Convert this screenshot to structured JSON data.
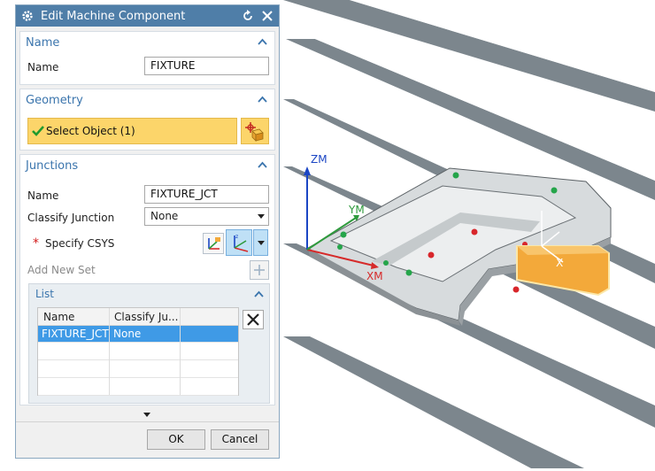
{
  "dialog": {
    "title": "Edit Machine Component",
    "icons": {
      "gear": "gear-icon",
      "reset": "reset-icon",
      "close": "close-icon"
    }
  },
  "name_section": {
    "header": "Name",
    "name_label": "Name",
    "name_value": "FIXTURE"
  },
  "geometry_section": {
    "header": "Geometry",
    "select_object_label": "Select Object (1)"
  },
  "junctions_section": {
    "header": "Junctions",
    "name_label": "Name",
    "name_value": "FIXTURE_JCT",
    "classify_label": "Classify Junction",
    "classify_value": "None",
    "required_marker": "*",
    "csys_label": "Specify CSYS",
    "add_new_set_label": "Add New Set",
    "list": {
      "header": "List",
      "columns": [
        "Name",
        "Classify Ju..."
      ],
      "rows": [
        {
          "name": "FIXTURE_JCT",
          "classify": "None",
          "selected": true
        }
      ]
    }
  },
  "buttons": {
    "ok": "OK",
    "cancel": "Cancel"
  },
  "viewport": {
    "axis_labels": {
      "zm": "ZM",
      "ym": "YM",
      "xm": "XM",
      "x": "X"
    }
  },
  "colors": {
    "titlebar": "#4f7ea8",
    "section_header": "#3b75ad",
    "selection_yellow": "#fcd56a",
    "list_selection": "#3f9ae6",
    "part_gray": "#b9bec1",
    "highlight_orange": "#f3a93a"
  }
}
